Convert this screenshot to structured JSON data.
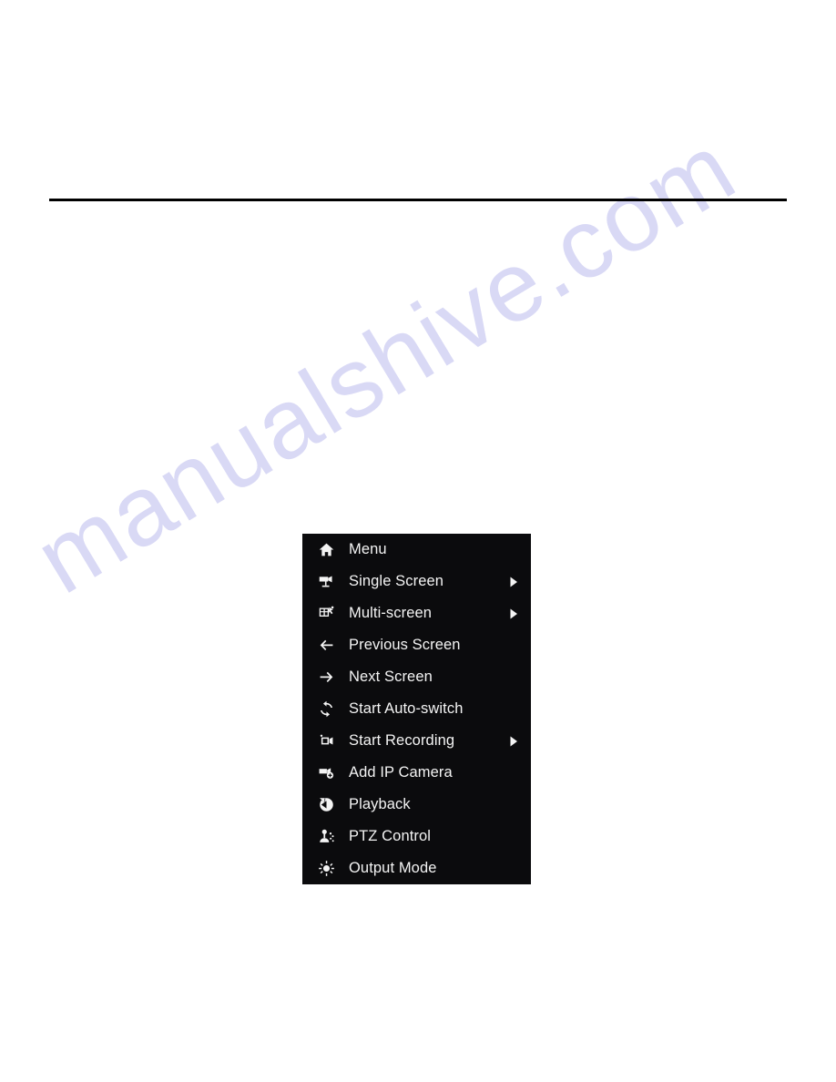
{
  "page": {
    "background_color": "#ffffff",
    "watermark_text": "manualshive.com",
    "watermark_color": "#d9d9f5"
  },
  "header": {
    "rule_color": "#000000"
  },
  "context_menu": {
    "background_color": "#0b0b0d",
    "text_color": "#f4f4f4",
    "items": [
      {
        "label": "Menu",
        "icon": "home-icon",
        "has_submenu": false
      },
      {
        "label": "Single Screen",
        "icon": "single-camera-icon",
        "has_submenu": true
      },
      {
        "label": "Multi-screen",
        "icon": "multi-screen-icon",
        "has_submenu": true
      },
      {
        "label": "Previous Screen",
        "icon": "arrow-left-icon",
        "has_submenu": false
      },
      {
        "label": "Next Screen",
        "icon": "arrow-right-icon",
        "has_submenu": false
      },
      {
        "label": "Start Auto-switch",
        "icon": "auto-switch-icon",
        "has_submenu": false
      },
      {
        "label": "Start Recording",
        "icon": "video-camera-icon",
        "has_submenu": true
      },
      {
        "label": "Add IP Camera",
        "icon": "add-camera-icon",
        "has_submenu": false
      },
      {
        "label": "Playback",
        "icon": "playback-icon",
        "has_submenu": false
      },
      {
        "label": "PTZ Control",
        "icon": "ptz-joystick-icon",
        "has_submenu": false
      },
      {
        "label": "Output Mode",
        "icon": "brightness-icon",
        "has_submenu": false
      }
    ]
  }
}
